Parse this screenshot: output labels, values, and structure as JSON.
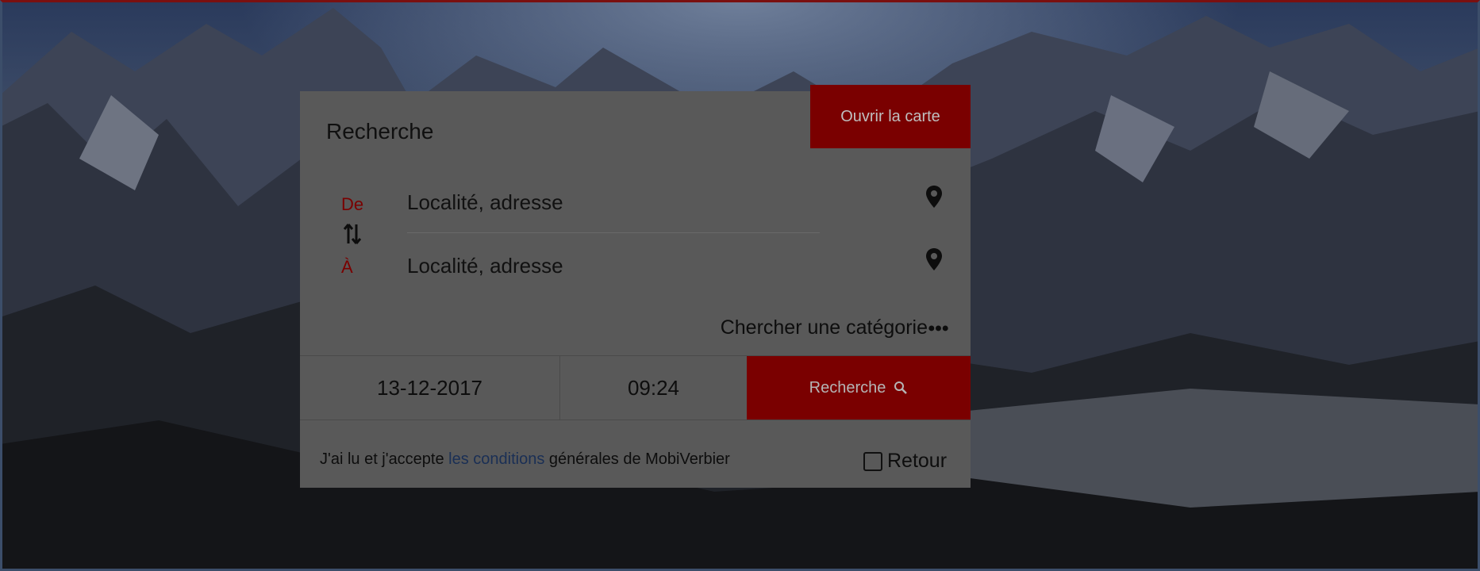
{
  "search": {
    "title": "Recherche",
    "open_map_label": "Ouvrir la carte",
    "from_label": "De",
    "to_label": "À",
    "from_placeholder": "Localité, adresse",
    "to_placeholder": "Localité, adresse",
    "category_label": "Chercher une catégorie",
    "date": "13-12-2017",
    "time": "09:24",
    "submit_label": "Recherche",
    "terms_prefix": "J'ai lu et j'accepte ",
    "terms_link": "les conditions",
    "terms_suffix": " générales de MobiVerbier",
    "return_label": "Retour",
    "return_checked": false
  },
  "colors": {
    "accent": "#7a0000",
    "card": "#595959",
    "link": "#1a2f55"
  },
  "icons": {
    "swap": "swap-vertical-icon",
    "pin": "location-pin-icon",
    "search": "search-icon",
    "more": "ellipsis-icon"
  }
}
